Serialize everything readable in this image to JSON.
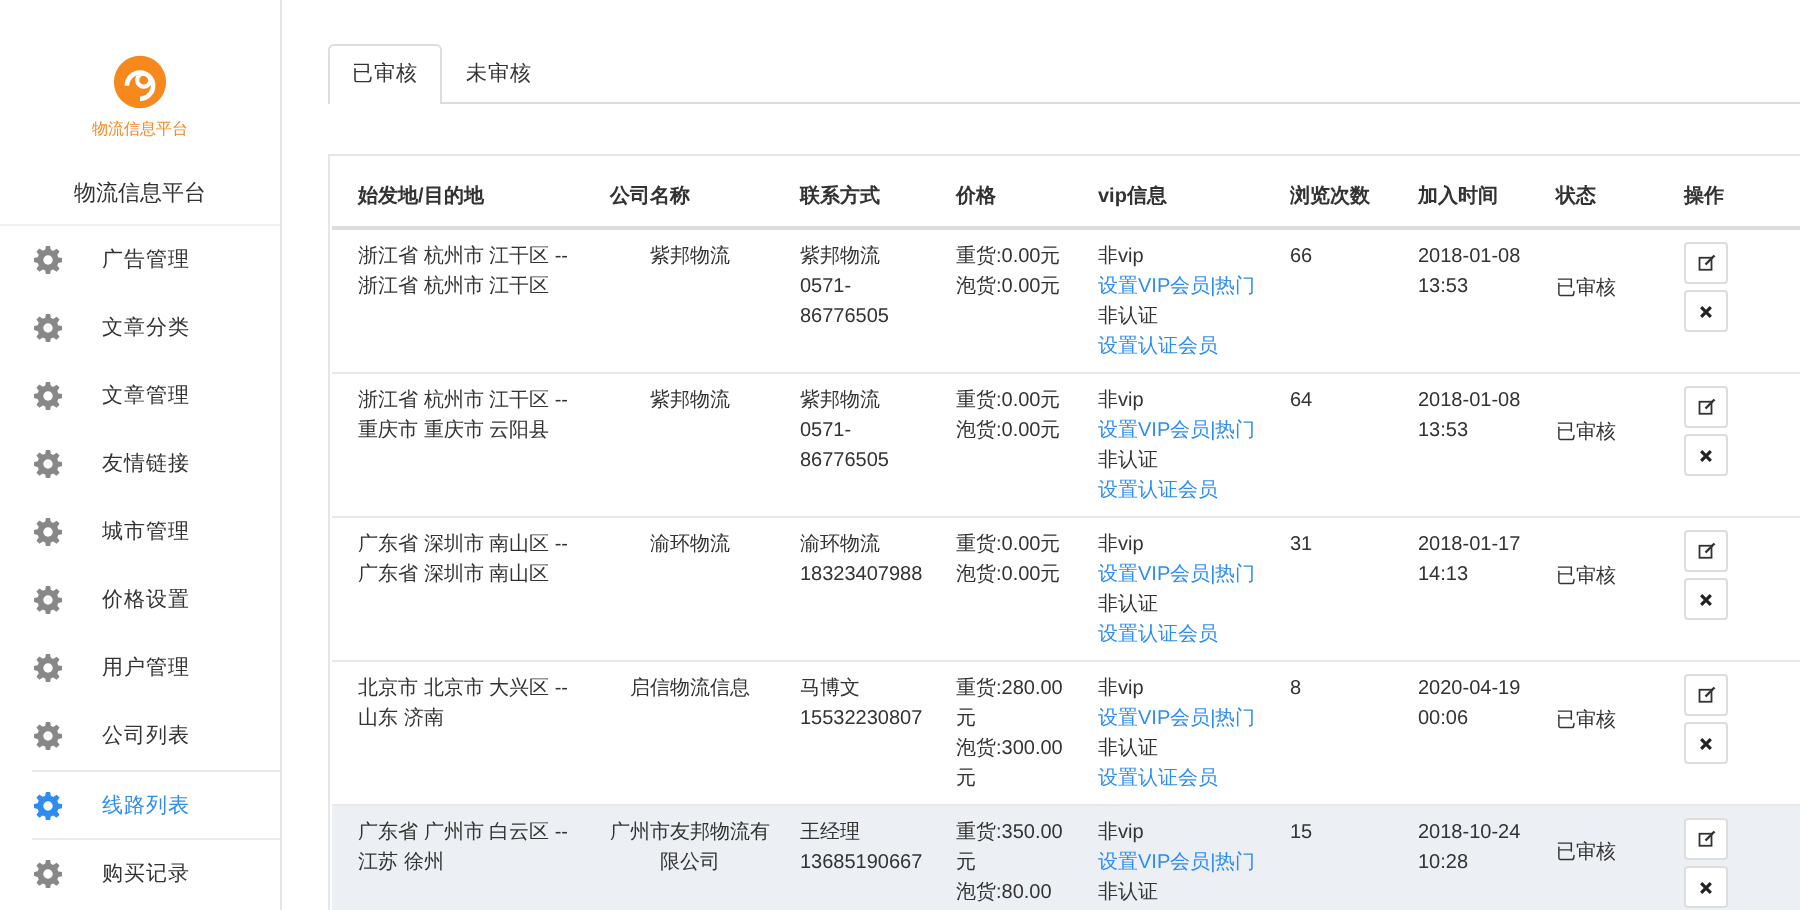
{
  "sidebar": {
    "logo_text": "物流信息平台",
    "title": "物流信息平台",
    "items": [
      {
        "label": "广告管理",
        "selected": false
      },
      {
        "label": "文章分类",
        "selected": false
      },
      {
        "label": "文章管理",
        "selected": false
      },
      {
        "label": "友情链接",
        "selected": false
      },
      {
        "label": "城市管理",
        "selected": false
      },
      {
        "label": "价格设置",
        "selected": false
      },
      {
        "label": "用户管理",
        "selected": false
      },
      {
        "label": "公司列表",
        "selected": false
      },
      {
        "label": "线路列表",
        "selected": true
      },
      {
        "label": "购买记录",
        "selected": false
      }
    ]
  },
  "tabs": [
    {
      "label": "已审核",
      "selected": true
    },
    {
      "label": "未审核",
      "selected": false
    }
  ],
  "table": {
    "columns": [
      "始发地/目的地",
      "公司名称",
      "联系方式",
      "价格",
      "vip信息",
      "浏览次数",
      "加入时间",
      "状态",
      "操作"
    ],
    "rows": [
      {
        "route": "浙江省 杭州市 江干区 -- 浙江省 杭州市 江干区",
        "company": "紫邦物流",
        "contact": [
          "紫邦物流",
          "0571-86776505"
        ],
        "price": [
          "重货:0.00元",
          "泡货:0.00元"
        ],
        "vip": [
          "非vip",
          "设置VIP会员|热门",
          "非认证",
          "设置认证会员"
        ],
        "views": "66",
        "time": "2018-01-08 13:53",
        "status": "已审核",
        "hovered": false
      },
      {
        "route": "浙江省 杭州市 江干区 -- 重庆市 重庆市 云阳县",
        "company": "紫邦物流",
        "contact": [
          "紫邦物流",
          "0571-86776505"
        ],
        "price": [
          "重货:0.00元",
          "泡货:0.00元"
        ],
        "vip": [
          "非vip",
          "设置VIP会员|热门",
          "非认证",
          "设置认证会员"
        ],
        "views": "64",
        "time": "2018-01-08 13:53",
        "status": "已审核",
        "hovered": false
      },
      {
        "route": "广东省 深圳市 南山区 -- 广东省 深圳市 南山区",
        "company": "渝环物流",
        "contact": [
          "渝环物流",
          "18323407988"
        ],
        "price": [
          "重货:0.00元",
          "泡货:0.00元"
        ],
        "vip": [
          "非vip",
          "设置VIP会员|热门",
          "非认证",
          "设置认证会员"
        ],
        "views": "31",
        "time": "2018-01-17 14:13",
        "status": "已审核",
        "hovered": false
      },
      {
        "route": "北京市 北京市 大兴区 -- 山东 济南",
        "company": "启信物流信息",
        "contact": [
          "马博文",
          "15532230807"
        ],
        "price": [
          "重货:280.00元",
          "泡货:300.00元"
        ],
        "vip": [
          "非vip",
          "设置VIP会员|热门",
          "非认证",
          "设置认证会员"
        ],
        "views": "8",
        "time": "2020-04-19 00:06",
        "status": "已审核",
        "hovered": false
      },
      {
        "route": "广东省 广州市 白云区 -- 江苏 徐州",
        "company": "广州市友邦物流有限公司",
        "contact": [
          "王经理",
          "13685190667"
        ],
        "price": [
          "重货:350.00元",
          "泡货:80.00"
        ],
        "vip": [
          "非vip",
          "设置VIP会员|热门",
          "非认证"
        ],
        "views": "15",
        "time": "2018-10-24 10:28",
        "status": "已审核",
        "hovered": true
      }
    ]
  }
}
